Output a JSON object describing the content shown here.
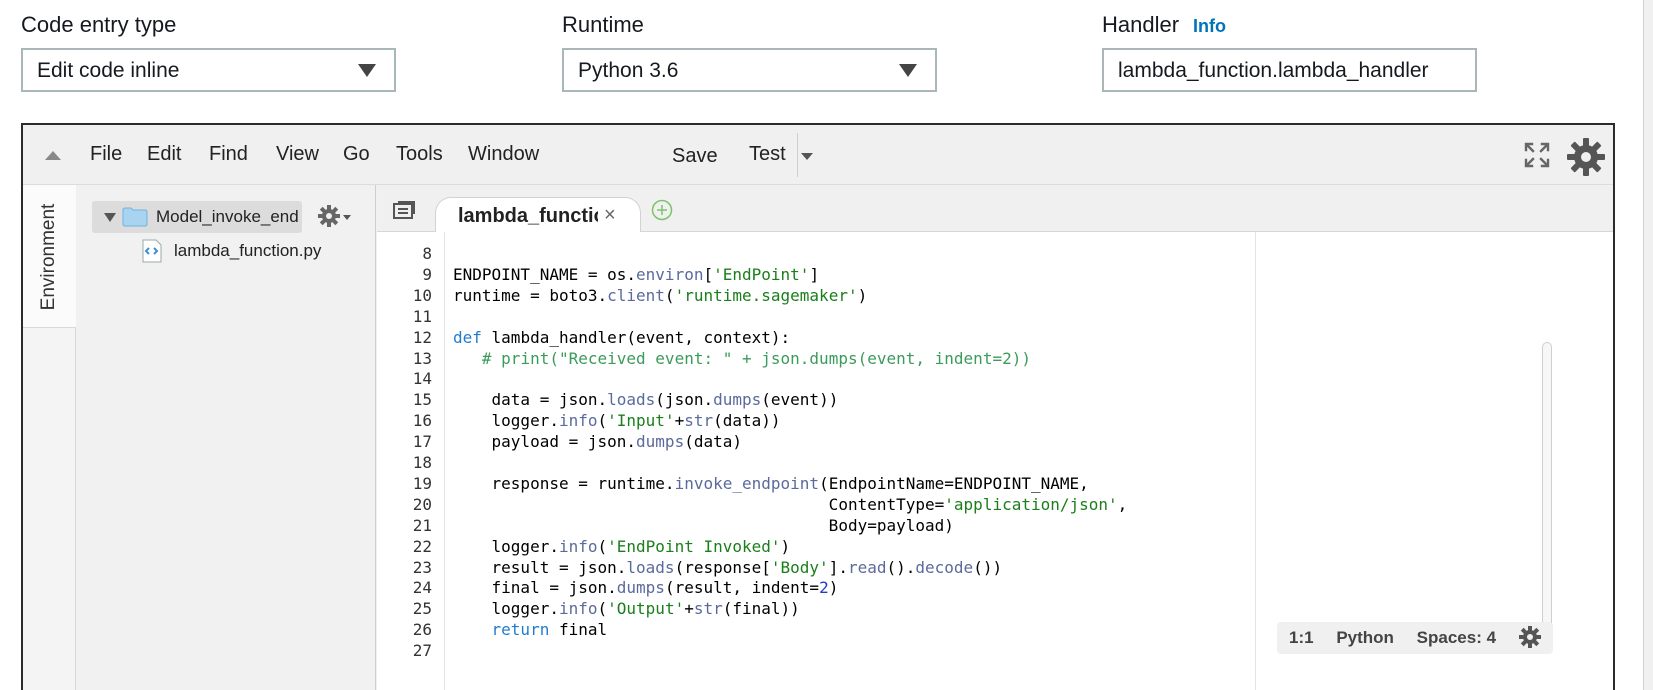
{
  "form": {
    "code_entry_label": "Code entry type",
    "code_entry_value": "Edit code inline",
    "runtime_label": "Runtime",
    "runtime_value": "Python 3.6",
    "handler_label": "Handler",
    "handler_info": "Info",
    "handler_value": "lambda_function.lambda_handler"
  },
  "ide": {
    "menu": [
      "File",
      "Edit",
      "Find",
      "View",
      "Go",
      "Tools",
      "Window"
    ],
    "save_label": "Save",
    "test_label": "Test",
    "env_tab": "Environment",
    "tree": {
      "root": "Model_invoke_endpoint",
      "file": "lambda_function.py"
    },
    "tab_label": "lambda_function",
    "status": {
      "position": "1:1",
      "mode": "Python",
      "spaces": "Spaces: 4"
    }
  },
  "code_lines": [
    {
      "n": "8",
      "t": ""
    },
    {
      "n": "9",
      "t": "ENDPOINT_NAME = os.environ['EndPoint']"
    },
    {
      "n": "10",
      "t": "runtime = boto3.client('runtime.sagemaker')"
    },
    {
      "n": "11",
      "t": ""
    },
    {
      "n": "12",
      "t": "def lambda_handler(event, context):"
    },
    {
      "n": "13",
      "t": "   # print(\"Received event: \" + json.dumps(event, indent=2))"
    },
    {
      "n": "14",
      "t": ""
    },
    {
      "n": "15",
      "t": "    data = json.loads(json.dumps(event))"
    },
    {
      "n": "16",
      "t": "    logger.info('Input'+str(data))"
    },
    {
      "n": "17",
      "t": "    payload = json.dumps(data)"
    },
    {
      "n": "18",
      "t": ""
    },
    {
      "n": "19",
      "t": "    response = runtime.invoke_endpoint(EndpointName=ENDPOINT_NAME,"
    },
    {
      "n": "20",
      "t": "                                       ContentType='application/json',"
    },
    {
      "n": "21",
      "t": "                                       Body=payload)"
    },
    {
      "n": "22",
      "t": "    logger.info('EndPoint Invoked')"
    },
    {
      "n": "23",
      "t": "    result = json.loads(response['Body'].read().decode())"
    },
    {
      "n": "24",
      "t": "    final = json.dumps(result, indent=2)"
    },
    {
      "n": "25",
      "t": "    logger.info('Output'+str(final))"
    },
    {
      "n": "26",
      "t": "    return final"
    },
    {
      "n": "27",
      "t": ""
    }
  ],
  "colors": {
    "keyword": "#1f7ccf",
    "string": "#1a7f1a",
    "comment": "#3b9b5a",
    "info_link": "#0073bb"
  }
}
